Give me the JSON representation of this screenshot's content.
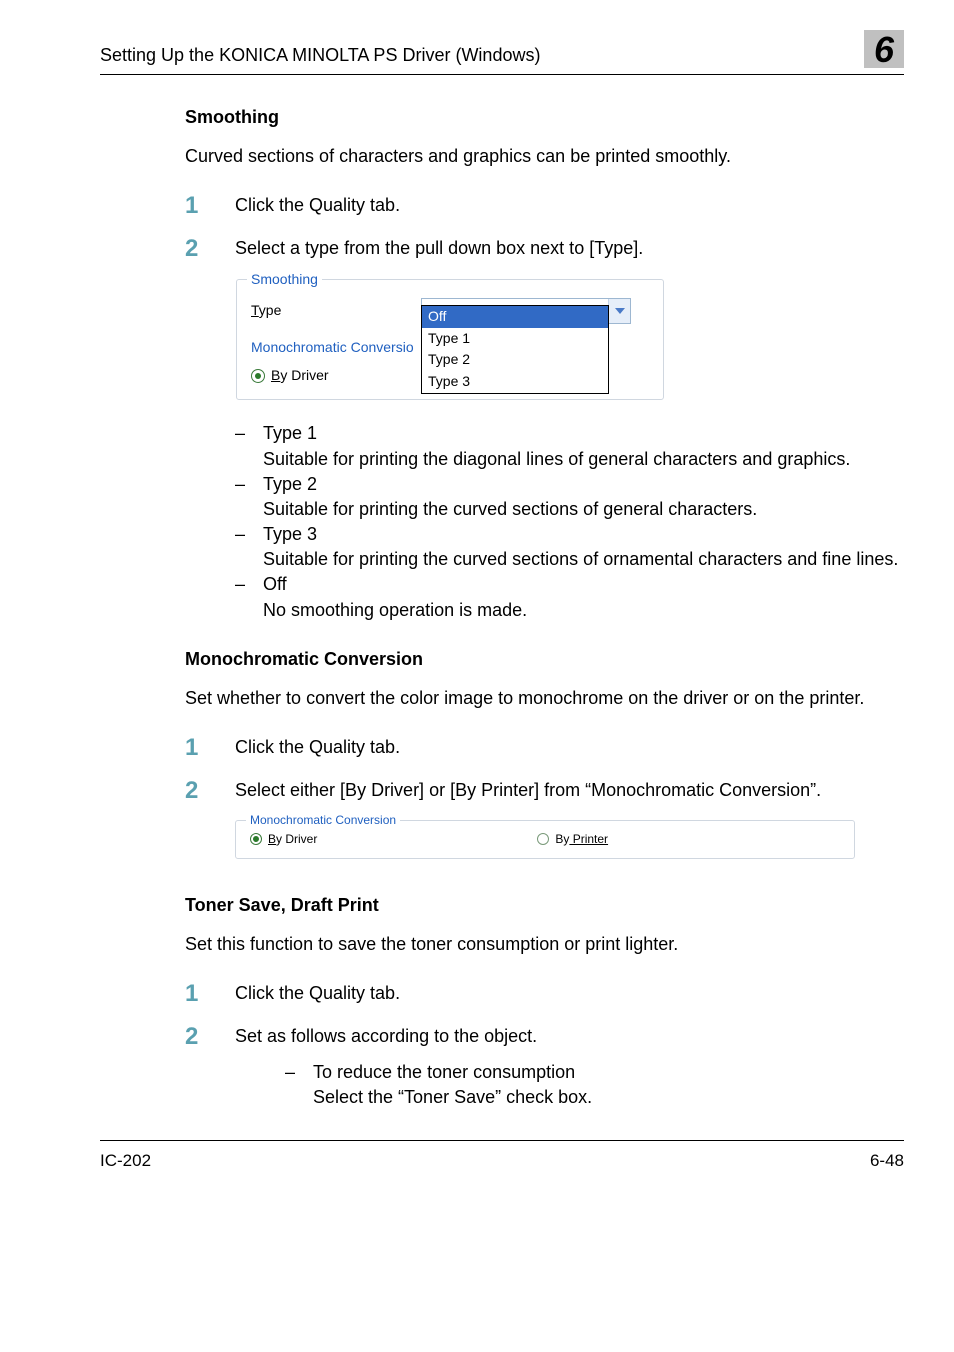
{
  "header": {
    "title": "Setting Up the KONICA MINOLTA PS Driver (Windows)",
    "chapter": "6"
  },
  "sections": {
    "smoothing": {
      "heading": "Smoothing",
      "intro": "Curved sections of characters and graphics can be printed smoothly.",
      "step1": "Click the Quality tab.",
      "step2": "Select a type from the pull down box next to [Type].",
      "types": {
        "t1_label": "Type 1",
        "t1_desc": "Suitable for printing the diagonal lines of general characters and graphics.",
        "t2_label": "Type 2",
        "t2_desc": "Suitable for printing the curved sections of general characters.",
        "t3_label": "Type 3",
        "t3_desc": "Suitable for printing the curved sections of ornamental characters and fine lines.",
        "off_label": "Off",
        "off_desc": "No smoothing operation is made."
      }
    },
    "mono": {
      "heading": "Monochromatic Conversion",
      "intro": "Set whether to convert the color image to monochrome on the driver or on the printer.",
      "step1": "Click the Quality tab.",
      "step2": "Select either [By Driver] or [By Printer] from “Monochromatic Conversion”."
    },
    "toner": {
      "heading": "Toner Save, Draft Print",
      "intro": "Set this function to save the toner consumption or print lighter.",
      "step1": "Click the Quality tab.",
      "step2": "Set as follows according to the object.",
      "sub1_label": "To reduce the toner consumption",
      "sub1_desc": "Select the “Toner Save” check box."
    }
  },
  "fig1": {
    "legend": "Smoothing",
    "type_label_pre": "T",
    "type_label_rest": "ype",
    "combo_value": "Off",
    "options": [
      "Off",
      "Type 1",
      "Type 2",
      "Type 3"
    ],
    "mono_label": "Monochromatic Conversio",
    "radio_label_pre": "B",
    "radio_label_rest": "y Driver"
  },
  "fig2": {
    "legend": "Monochromatic Conversion",
    "r1_pre": "B",
    "r1_rest": "y Driver",
    "r2_pre": "By",
    "r2_rest": " Printer"
  },
  "footer": {
    "left": "IC-202",
    "right": "6-48"
  }
}
